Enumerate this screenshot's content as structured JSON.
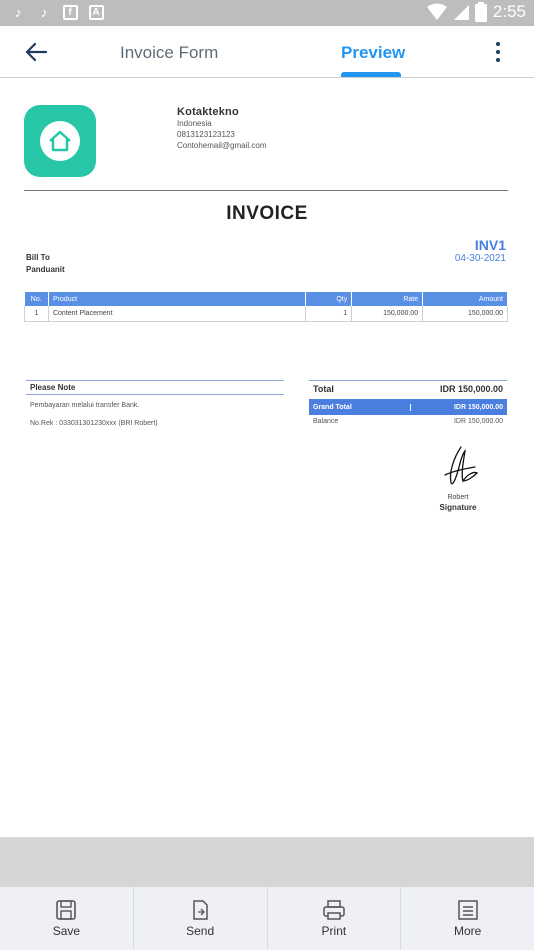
{
  "status_bar": {
    "time": "2:55",
    "left_icons": [
      "tiktok-icon",
      "tiktok-icon",
      "facebook-icon",
      "app-icon"
    ],
    "right_icons": [
      "wifi-icon",
      "signal-icon",
      "battery-icon"
    ]
  },
  "app_bar": {
    "tab_form": "Invoice Form",
    "tab_preview": "Preview",
    "active_tab": "Preview",
    "accent": "#2196f3"
  },
  "invoice": {
    "company": {
      "name": "Kotaktekno",
      "country": "Indonesia",
      "phone": "0813123123123",
      "email": "Contohemail@gmail.com"
    },
    "title": "INVOICE",
    "bill_to_label": "Bill To",
    "bill_to_name": "Panduanit",
    "number": "INV1",
    "date": "04-30-2021",
    "table": {
      "headers": [
        "No.",
        "Product",
        "Qty",
        "Rate",
        "Amount"
      ],
      "rows": [
        {
          "no": "1",
          "product": "Content Placement",
          "qty": "1",
          "rate": "150,000.00",
          "amount": "150,000.00"
        }
      ]
    },
    "note": {
      "label": "Please Note",
      "lines": [
        "Pembayaran melalui transfer Bank.",
        "No.Rek : 033031301230xxx (BRI Robert)"
      ]
    },
    "totals": {
      "total_label": "Total",
      "total_value": "IDR 150,000.00",
      "grand_total_label": "Grand Total",
      "grand_total_value": "IDR 150,000.00",
      "balance_label": "Balance",
      "balance_value": "IDR 150,000.00"
    },
    "signature": {
      "name": "Robert",
      "label": "Signature"
    }
  },
  "bottom_bar": {
    "save": "Save",
    "send": "Send",
    "print": "Print",
    "more": "More"
  }
}
